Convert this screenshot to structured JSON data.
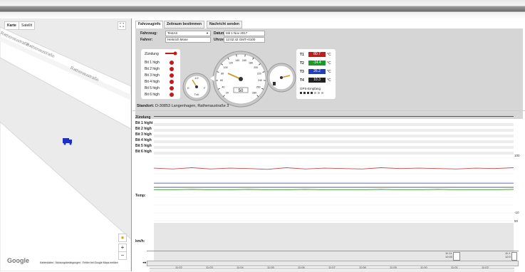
{
  "map": {
    "tabs": [
      "Karte",
      "Satellit"
    ],
    "streets": [
      "Rathenaustraße",
      "Rathenaustraße",
      "Rathenaustraße"
    ],
    "google": "Google",
    "footer": [
      "Kartendaten",
      "Nutzungsbedingungen",
      "Fehler bei Google Maps melden"
    ],
    "zoom_in": "+",
    "zoom_out": "−"
  },
  "tabs": [
    "Fahrzeuginfo",
    "Zeitraum bestimmen",
    "Nachricht senden"
  ],
  "info": {
    "vehicle_label": "Fahrzeug:",
    "vehicle_value": "TestAS",
    "driver_label": "Fahrer:",
    "driver_value": "Heinrich Mose",
    "date_label": "Datum:",
    "date_value": "Mit 1 Nov 2017",
    "time_label": "Uhrzeit:",
    "time_value": "12:02:42 GMT+0100"
  },
  "inputs": {
    "ignition": "Zündung",
    "bits": [
      "Bit 1 high",
      "Bit 2 high",
      "Bit 3 high",
      "Bit 4 high",
      "Bit 5 high",
      "Bit 6 high"
    ]
  },
  "gauges": {
    "tank_label": "Tnk",
    "speed_value": "50",
    "small_ticks": [
      "1/2",
      "E",
      "F"
    ],
    "speed_ticks": [
      "20",
      "40",
      "60",
      "80",
      "100",
      "120",
      "140",
      "160",
      "180",
      "200",
      "220",
      "240",
      "260",
      "280"
    ]
  },
  "temps": {
    "rows": [
      {
        "label": "T1",
        "value": "80.7",
        "unit": "°C",
        "color": "#c21b1b"
      },
      {
        "label": "T2",
        "value": "-14.4",
        "unit": "°C",
        "color": "#1a9a2a"
      },
      {
        "label": "T3",
        "value": "26.2",
        "unit": "°C",
        "color": "#1f3fbf"
      },
      {
        "label": "T4",
        "value": "10.3",
        "unit": "°C",
        "color": "#222222"
      }
    ],
    "gps_label": "GPS-Empfang",
    "gps_level": 4,
    "gps_total": 7
  },
  "location": {
    "label": "Standort:",
    "value": "D-30853 Langenhagen, Rathenaustraße 3"
  },
  "timeline": {
    "ignition": "Zündung",
    "bits": [
      "Bit 1 hight",
      "Bit 2 high",
      "Bit 3 high",
      "Bit 4 high",
      "Bit 5 high",
      "Bit 6 high"
    ],
    "temp_label": "Temp:",
    "kmh_label": "km/h:",
    "temp_axis_top": "100",
    "temp_axis_mid": "-10",
    "temp_axis_low": "50",
    "speed_axis_zero": "0",
    "time_start": "12:01",
    "time_mid": "12:02",
    "nav_times": [
      "11:11",
      "12:00",
      "11:1",
      "12:0"
    ],
    "bottom_ticks": [
      "11:02",
      "11:03",
      "11:04",
      "11:05",
      "11:06",
      "11:07",
      "11:08",
      "11:09",
      "11:00",
      "11:01",
      "11:02"
    ]
  },
  "chart_data": {
    "type": "line",
    "title": "",
    "series": [
      {
        "name": "T1",
        "color": "#c44a4a",
        "values": [
          76,
          74,
          77,
          74,
          76,
          75,
          73,
          77,
          74,
          76,
          75,
          74,
          77,
          75,
          76,
          75,
          74,
          76,
          75,
          77
        ]
      },
      {
        "name": "T2",
        "color": "#4a9a4a",
        "values": [
          24,
          24,
          25,
          24,
          24,
          25,
          24,
          24,
          25,
          24,
          24,
          24,
          25,
          24,
          24,
          25,
          24,
          24,
          24,
          25
        ]
      },
      {
        "name": "T3",
        "color": "#4a5ac4",
        "values": [
          40,
          40,
          40,
          40,
          40,
          40,
          40,
          40,
          40,
          40,
          40,
          40,
          40,
          40,
          40,
          40,
          40,
          40,
          40,
          40
        ]
      },
      {
        "name": "T4",
        "color": "#4a4a4a",
        "values": [
          30,
          30,
          30,
          30,
          30,
          30,
          30,
          30,
          30,
          30,
          30,
          30,
          30,
          30,
          30,
          30,
          30,
          30,
          30,
          30
        ]
      }
    ],
    "ylim": [
      -50,
      100
    ]
  }
}
